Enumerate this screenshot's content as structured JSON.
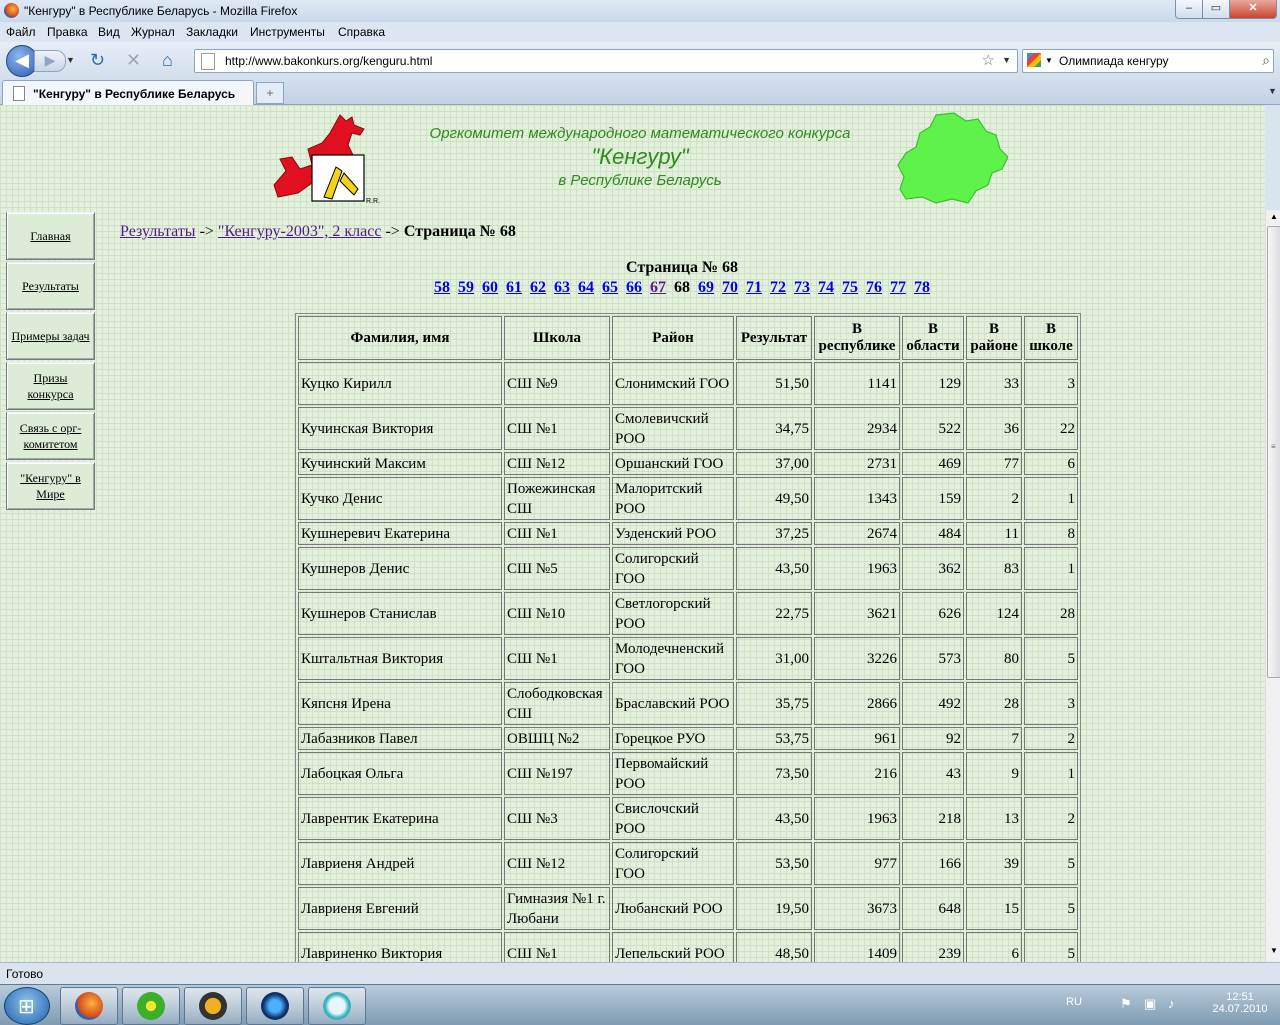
{
  "window": {
    "title": "\"Кенгуру\" в Республике Беларусь - Mozilla Firefox"
  },
  "menu": [
    "Файл",
    "Правка",
    "Вид",
    "Журнал",
    "Закладки",
    "Инструменты",
    "Справка"
  ],
  "nav": {
    "url": "http://www.bakonkurs.org/kenguru.html",
    "search_value": "Олимпиада кенгуру"
  },
  "tab": {
    "label": "\"Кенгуру\" в Республике Беларусь",
    "new_tab": "+"
  },
  "banner": {
    "line1": "Оргкомитет международного математического конкурса",
    "line2": "\"Кенгуру\"",
    "line3": "в Республике Беларусь",
    "logo_mark": "R.R."
  },
  "sidebar": [
    "Главная",
    "Результаты",
    "Примеры задач",
    "Призы конкурса",
    "Связь с орг-комитетом",
    "\"Кенгуру\" в Мире"
  ],
  "breadcrumb": {
    "link1": "Результаты",
    "sep": " -> ",
    "link2": "\"Кенгуру-2003\", 2 класс",
    "current": "Страница № 68"
  },
  "page_heading": "Страница № 68",
  "pager": {
    "before": [
      "58",
      "59",
      "60",
      "61",
      "62",
      "63",
      "64",
      "65",
      "66"
    ],
    "visited": "67",
    "current": "68",
    "after": [
      "69",
      "70",
      "71",
      "72",
      "73",
      "74",
      "75",
      "76",
      "77",
      "78"
    ]
  },
  "table": {
    "headers": [
      "Фамилия, имя",
      "Школа",
      "Район",
      "Результат",
      "В республике",
      "В области",
      "В районе",
      "В школе"
    ],
    "rows": [
      [
        "Куцко Кирилл",
        "СШ №9",
        "Слонимский ГОО",
        "51,50",
        "1141",
        "129",
        "33",
        "3"
      ],
      [
        "Кучинская Виктория",
        "СШ №1",
        "Смолевичский РОО",
        "34,75",
        "2934",
        "522",
        "36",
        "22"
      ],
      [
        "Кучинский Максим",
        "СШ №12",
        "Оршанский ГОО",
        "37,00",
        "2731",
        "469",
        "77",
        "6"
      ],
      [
        "Кучко Денис",
        "Пожежинская СШ",
        "Малоритский РОО",
        "49,50",
        "1343",
        "159",
        "2",
        "1"
      ],
      [
        "Кушнеревич Екатерина",
        "СШ №1",
        "Узденский РОО",
        "37,25",
        "2674",
        "484",
        "11",
        "8"
      ],
      [
        "Кушнеров Денис",
        "СШ №5",
        "Солигорский ГОО",
        "43,50",
        "1963",
        "362",
        "83",
        "1"
      ],
      [
        "Кушнеров Станислав",
        "СШ №10",
        "Светлогорский РОО",
        "22,75",
        "3621",
        "626",
        "124",
        "28"
      ],
      [
        "Кштальтная Виктория",
        "СШ №1",
        "Молодечненский ГОО",
        "31,00",
        "3226",
        "573",
        "80",
        "5"
      ],
      [
        "Кяпсня Ирена",
        "Слободковская СШ",
        "Браславский РОО",
        "35,75",
        "2866",
        "492",
        "28",
        "3"
      ],
      [
        "Лабазников Павел",
        "ОВШЦ №2",
        "Горецкое РУО",
        "53,75",
        "961",
        "92",
        "7",
        "2"
      ],
      [
        "Лабоцкая Ольга",
        "СШ №197",
        "Первомайский РОО",
        "73,50",
        "216",
        "43",
        "9",
        "1"
      ],
      [
        "Лаврентик Екатерина",
        "СШ №3",
        "Свислочский РОО",
        "43,50",
        "1963",
        "218",
        "13",
        "2"
      ],
      [
        "Лавриеня Андрей",
        "СШ №12",
        "Солигорский ГОО",
        "53,50",
        "977",
        "166",
        "39",
        "5"
      ],
      [
        "Лавриеня Евгений",
        "Гимназия №1 г. Любани",
        "Любанский РОО",
        "19,50",
        "3673",
        "648",
        "15",
        "5"
      ],
      [
        "Лавриненко Виктория",
        "СШ №1",
        "Лепельский РОО",
        "48,50",
        "1409",
        "239",
        "6",
        "5"
      ]
    ]
  },
  "status": "Готово",
  "tray": {
    "lang": "RU",
    "time": "12:51",
    "date": "24.07.2010"
  }
}
